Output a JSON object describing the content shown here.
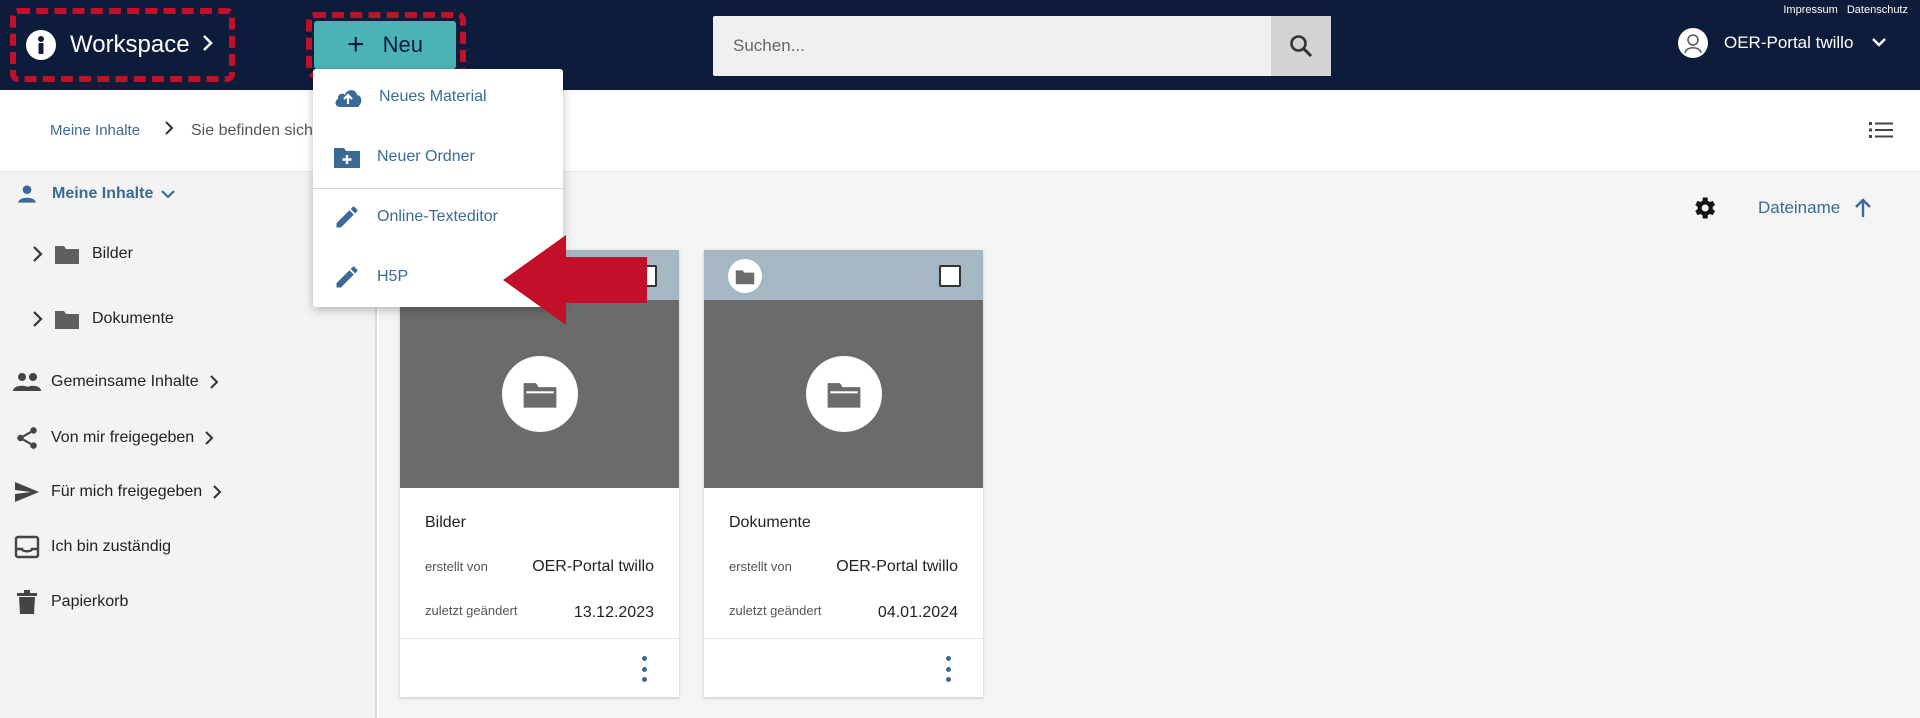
{
  "header": {
    "workspace_label": "Workspace",
    "new_label": "Neu",
    "search_placeholder": "Suchen...",
    "links": [
      "Impressum",
      "Datenschutz"
    ],
    "user_name": "OER-Portal twillo"
  },
  "new_menu": {
    "items": [
      "Neues Material",
      "Neuer Ordner",
      "Online-Texteditor",
      "H5P"
    ]
  },
  "breadcrumb": {
    "home": "Meine Inhalte",
    "current": "Sie befinden sich"
  },
  "sidebar": {
    "my_contents": "Meine Inhalte",
    "folders": [
      "Bilder",
      "Dokumente"
    ],
    "items": [
      "Gemeinsame Inhalte",
      "Von mir freigegeben",
      "Für mich freigegeben",
      "Ich bin zuständig",
      "Papierkorb"
    ]
  },
  "sort": {
    "label": "Dateiname"
  },
  "cards": [
    {
      "title": "Bilder",
      "created_by_label": "erstellt von",
      "created_by": "OER-Portal twillo",
      "modified_label": "zuletzt geändert",
      "modified": "13.12.2023"
    },
    {
      "title": "Dokumente",
      "created_by_label": "erstellt von",
      "created_by": "OER-Portal twillo",
      "modified_label": "zuletzt geändert",
      "modified": "04.01.2024"
    }
  ],
  "colors": {
    "topbar": "#0e1c3c",
    "accent": "#4bb3b5",
    "highlight": "#c2102a",
    "link": "#3c6a96"
  }
}
